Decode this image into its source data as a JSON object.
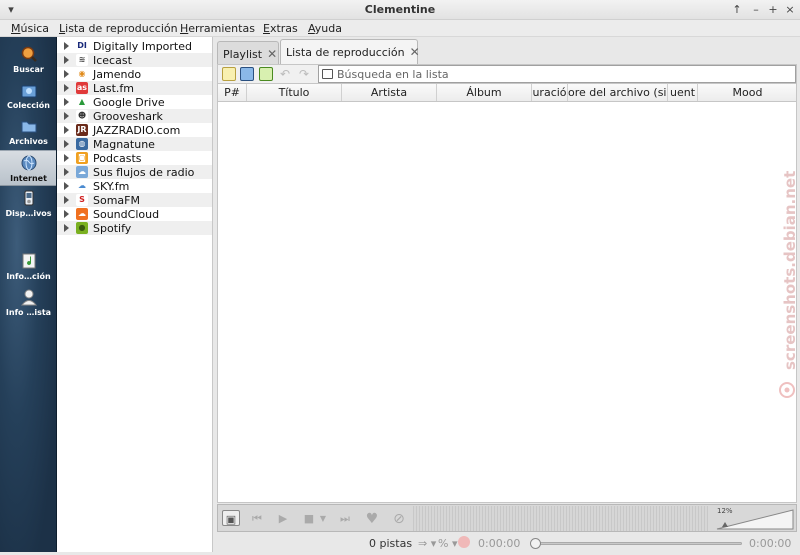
{
  "window": {
    "title": "Clementine"
  },
  "menu": [
    {
      "label": "Música",
      "underline": "M",
      "rest": "úsica"
    },
    {
      "label": "Lista de reproducción",
      "underline": "L",
      "rest": "ista de reproducción"
    },
    {
      "label": "Herramientas",
      "underline": "H",
      "rest": "erramientas"
    },
    {
      "label": "Extras",
      "underline": "E",
      "rest": "xtras"
    },
    {
      "label": "Ayuda",
      "underline": "A",
      "rest": "yuda"
    }
  ],
  "sidebar": [
    {
      "label": "Buscar",
      "icon": "search-icon",
      "active": false
    },
    {
      "label": "Colección",
      "icon": "library-icon",
      "active": false
    },
    {
      "label": "Archivos",
      "icon": "folder-icon",
      "active": false
    },
    {
      "label": "Internet",
      "icon": "globe-icon",
      "active": true
    },
    {
      "label": "Disp…ivos",
      "icon": "device-icon",
      "active": false
    },
    {
      "label": "Info…ción",
      "icon": "song-info-icon",
      "active": false
    },
    {
      "label": "Info …ista",
      "icon": "artist-info-icon",
      "active": false
    }
  ],
  "services": [
    {
      "label": "Digitally Imported",
      "icon": "digitally-imported-icon",
      "glyph": "DI",
      "color": "#ffffff",
      "fg": "#1a2a7a"
    },
    {
      "label": "Icecast",
      "icon": "icecast-icon",
      "glyph": "≋",
      "color": "#ffffff",
      "fg": "#444444"
    },
    {
      "label": "Jamendo",
      "icon": "jamendo-icon",
      "glyph": "◉",
      "color": "#ffffff",
      "fg": "#e08a1a"
    },
    {
      "label": "Last.fm",
      "icon": "lastfm-icon",
      "glyph": "as",
      "color": "#e03a3a",
      "fg": "#ffffff"
    },
    {
      "label": "Google Drive",
      "icon": "google-drive-icon",
      "glyph": "▲",
      "color": "#ffffff",
      "fg": "#2a9a3a"
    },
    {
      "label": "Grooveshark",
      "icon": "grooveshark-icon",
      "glyph": "☻",
      "color": "#ffffff",
      "fg": "#333333"
    },
    {
      "label": "JAZZRADIO.com",
      "icon": "jazzradio-icon",
      "glyph": "JR",
      "color": "#6a2a1a",
      "fg": "#ffffff"
    },
    {
      "label": "Magnatune",
      "icon": "magnatune-icon",
      "glyph": "◍",
      "color": "#3a6aa0",
      "fg": "#ffffff"
    },
    {
      "label": "Podcasts",
      "icon": "podcast-icon",
      "glyph": "◙",
      "color": "#f0a020",
      "fg": "#ffffff"
    },
    {
      "label": "Sus flujos de radio",
      "icon": "radio-stream-icon",
      "glyph": "☁",
      "color": "#7aa8d8",
      "fg": "#ffffff"
    },
    {
      "label": "SKY.fm",
      "icon": "skyfm-icon",
      "glyph": "☁",
      "color": "#ffffff",
      "fg": "#4a8ad0"
    },
    {
      "label": "SomaFM",
      "icon": "somafm-icon",
      "glyph": "S",
      "color": "#ffffff",
      "fg": "#d02020"
    },
    {
      "label": "SoundCloud",
      "icon": "soundcloud-icon",
      "glyph": "☁",
      "color": "#f07020",
      "fg": "#ffffff"
    },
    {
      "label": "Spotify",
      "icon": "spotify-icon",
      "glyph": "●",
      "color": "#7ab020",
      "fg": "#3a5a10"
    }
  ],
  "tabs": [
    {
      "label": "Playlist",
      "active": false
    },
    {
      "label": "Lista de reproducción",
      "active": true
    }
  ],
  "search": {
    "placeholder": "Búsqueda en la lista"
  },
  "columns": [
    "P#",
    "Título",
    "Artista",
    "Álbum",
    "uració",
    "ore del archivo (sin",
    "uent",
    "Mood"
  ],
  "status": {
    "tracks": "0 pistas",
    "elapsed": "0:00:00",
    "total": "0:00:00",
    "volume": "12%"
  },
  "watermark": "screenshots.debian.net",
  "colors": {
    "sidebar": "#22384f",
    "active_tab": "#f4f4f4"
  }
}
